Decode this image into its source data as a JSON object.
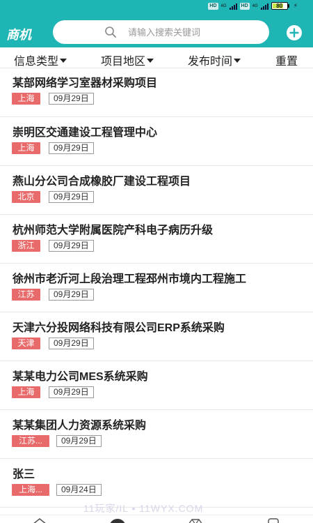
{
  "status_bar": {
    "network_1": "HD",
    "network_2": "HD",
    "signal_label_1": "4G",
    "signal_label_2": "4G",
    "battery": "80"
  },
  "header": {
    "app_title": "商机",
    "search_placeholder": "请输入搜索关键词",
    "add_icon": "plus-circle-icon",
    "accent_color": "#1fb5b5"
  },
  "filters": [
    {
      "label": "信息类型",
      "has_caret": true
    },
    {
      "label": "项目地区",
      "has_caret": true
    },
    {
      "label": "发布时间",
      "has_caret": true
    },
    {
      "label": "重置",
      "has_caret": false
    }
  ],
  "list": [
    {
      "title": "某部网络学习室器材采购项目",
      "region": "上海",
      "date": "09月29日"
    },
    {
      "title": "崇明区交通建设工程管理中心",
      "region": "上海",
      "date": "09月29日"
    },
    {
      "title": "燕山分公司合成橡胶厂建设工程项目",
      "region": "北京",
      "date": "09月29日"
    },
    {
      "title": "杭州师范大学附属医院产科电子病历升级",
      "region": "浙江",
      "date": "09月29日"
    },
    {
      "title": "徐州市老沂河上段治理工程邳州市境内工程施工",
      "region": "江苏",
      "date": "09月29日"
    },
    {
      "title": "天津六分投网络科技有限公司ERP系统采购",
      "region": "天津",
      "date": "09月29日"
    },
    {
      "title": "某某电力公司MES系统采购",
      "region": "上海",
      "date": "09月29日"
    },
    {
      "title": "某某集团人力资源系统采购",
      "region": "江苏...",
      "date": "09月29日"
    },
    {
      "title": "张三",
      "region": "上海...",
      "date": "09月24日"
    }
  ],
  "colors": {
    "region_tag": "#e86a6a",
    "divider": "#e8e8e8"
  },
  "watermark": "11玩家/IL • 11WYX.COM",
  "bottom_nav": [
    "home-icon",
    "center-icon",
    "diamond-icon",
    "profile-icon"
  ]
}
